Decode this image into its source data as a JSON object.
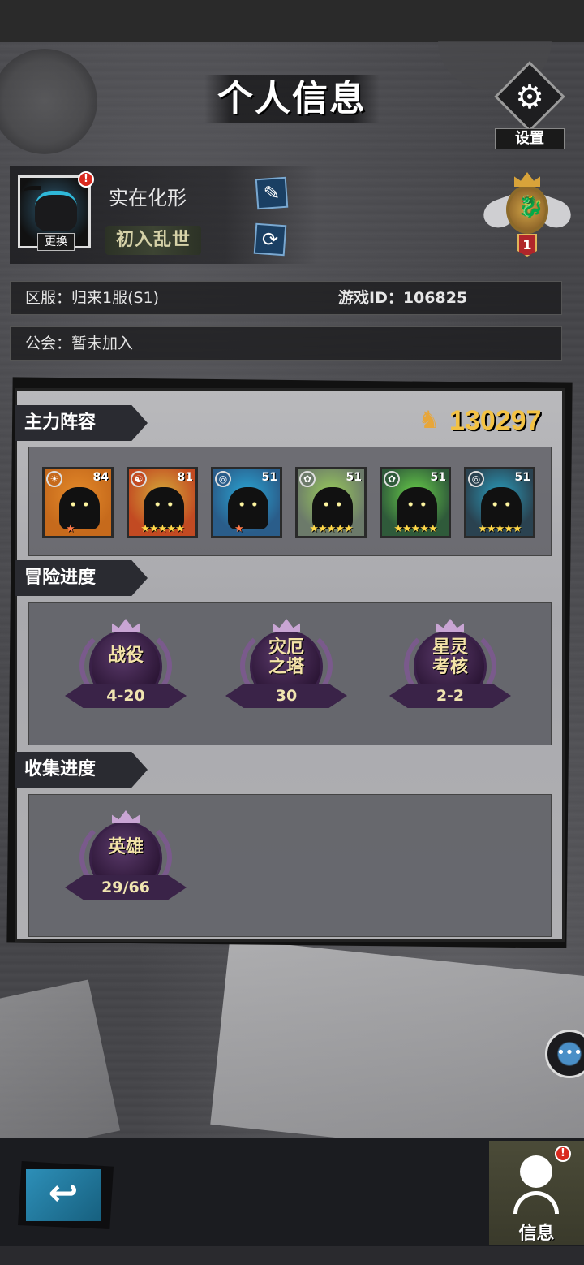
{
  "header": {
    "title": "个人信息",
    "settings_label": "设置"
  },
  "profile": {
    "name": "实在化形",
    "rank_title": "初入乱世",
    "change_label": "更换",
    "avatar_notification": "!",
    "level": "1"
  },
  "info": {
    "server_label": "区服：归来1服(S1)",
    "game_id_label": "游戏ID：106825",
    "guild_label": "公会：暂未加入"
  },
  "lineup": {
    "section_title": "主力阵容",
    "power": "130297",
    "heroes": [
      {
        "level": "84",
        "stars": "★",
        "element": "sun",
        "bg": "#c66a1c",
        "accent": "#e58b2a"
      },
      {
        "level": "81",
        "stars": "★★★★★",
        "element": "gold",
        "bg": "#c24a22",
        "accent": "#d6ae3a"
      },
      {
        "level": "51",
        "stars": "★",
        "element": "water",
        "bg": "#2a5d8a",
        "accent": "#2aa7d6"
      },
      {
        "level": "51",
        "stars": "★★★★★",
        "element": "wind",
        "bg": "#6c7a6a",
        "accent": "#9acf5a"
      },
      {
        "level": "51",
        "stars": "★★★★★",
        "element": "wind",
        "bg": "#2f5a3a",
        "accent": "#6ad34a"
      },
      {
        "level": "51",
        "stars": "★★★★★",
        "element": "water",
        "bg": "#2a4250",
        "accent": "#2a9fbf"
      }
    ]
  },
  "adventure": {
    "section_title": "冒险进度",
    "items": [
      {
        "name": "战役",
        "value": "4-20"
      },
      {
        "name": "灾厄之塔",
        "value": "30"
      },
      {
        "name": "星灵考核",
        "value": "2-2"
      }
    ]
  },
  "collection": {
    "section_title": "收集进度",
    "items": [
      {
        "name": "英雄",
        "value": "29/66"
      }
    ]
  },
  "bottom": {
    "info_tab_label": "信息",
    "info_notification": "!"
  }
}
